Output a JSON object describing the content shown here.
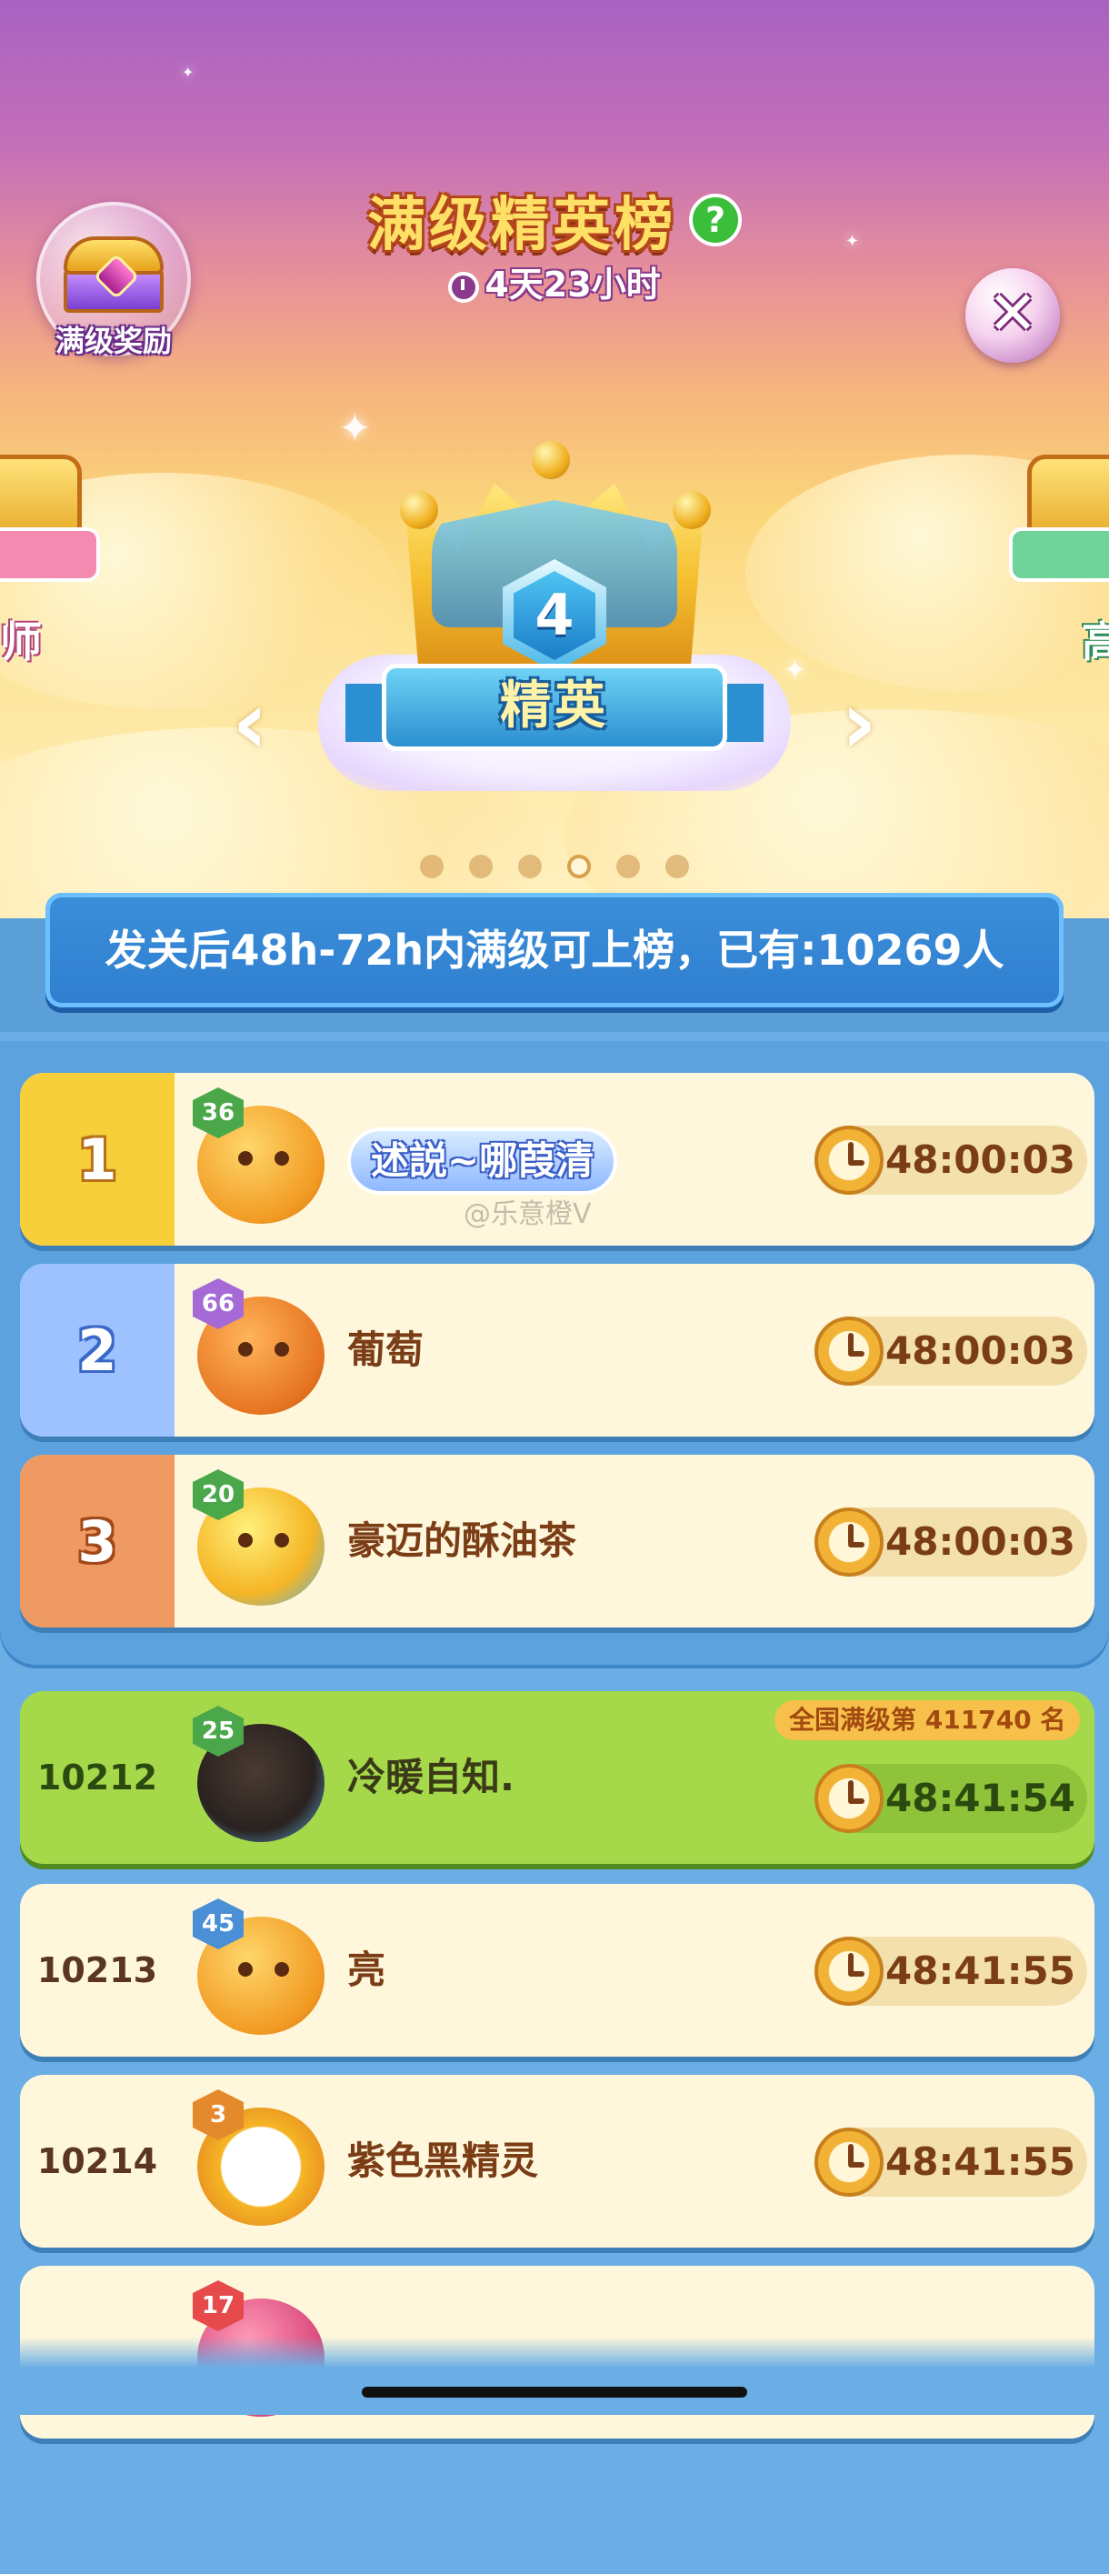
{
  "header": {
    "reward_label": "满级奖励",
    "title": "满级精英榜",
    "help_icon": "?",
    "countdown": "4天23小时",
    "close_icon": "✕"
  },
  "carousel": {
    "center_level": "4",
    "center_tier": "精英",
    "left_partial": "师",
    "right_partial": "高",
    "pages": 6,
    "active_page": 4
  },
  "banner": {
    "text": "发关后48h-72h内满级可上榜，已有:10269人"
  },
  "top_rows": [
    {
      "rank": "1",
      "level": "36",
      "name": "述説~哪葭清",
      "time": "48:00:03",
      "rank_color": "#f7cf3a",
      "level_color": "#4aa84a",
      "tagged": true
    },
    {
      "rank": "2",
      "level": "66",
      "name": "葡萄",
      "time": "48:00:03",
      "rank_color": "#9ec2ff",
      "level_color": "#a56ad6",
      "tagged": false
    },
    {
      "rank": "3",
      "level": "20",
      "name": "豪迈的酥油茶",
      "time": "48:00:03",
      "rank_color": "#ee9a62",
      "level_color": "#4aa84a",
      "tagged": false
    }
  ],
  "self_row": {
    "rank": "10212",
    "level": "25",
    "name": "冷暖自知.",
    "time": "48:41:54",
    "national_prefix": "全国满级第",
    "national_rank": "411740",
    "national_suffix": "名"
  },
  "other_rows": [
    {
      "rank": "10213",
      "level": "45",
      "name": "亮",
      "time": "48:41:55",
      "level_color": "#4b8fd6"
    },
    {
      "rank": "10214",
      "level": "3",
      "name": "紫色黑精灵",
      "time": "48:41:55",
      "level_color": "#e58a2c"
    },
    {
      "rank": "",
      "level": "17",
      "name": "",
      "time": "",
      "level_color": "#e64a4a"
    }
  ],
  "watermark": "@乐意橙V",
  "colors": {
    "accent": "#2f7ed0",
    "self_row": "#a6d94a",
    "row_bg": "#fff7dc"
  }
}
